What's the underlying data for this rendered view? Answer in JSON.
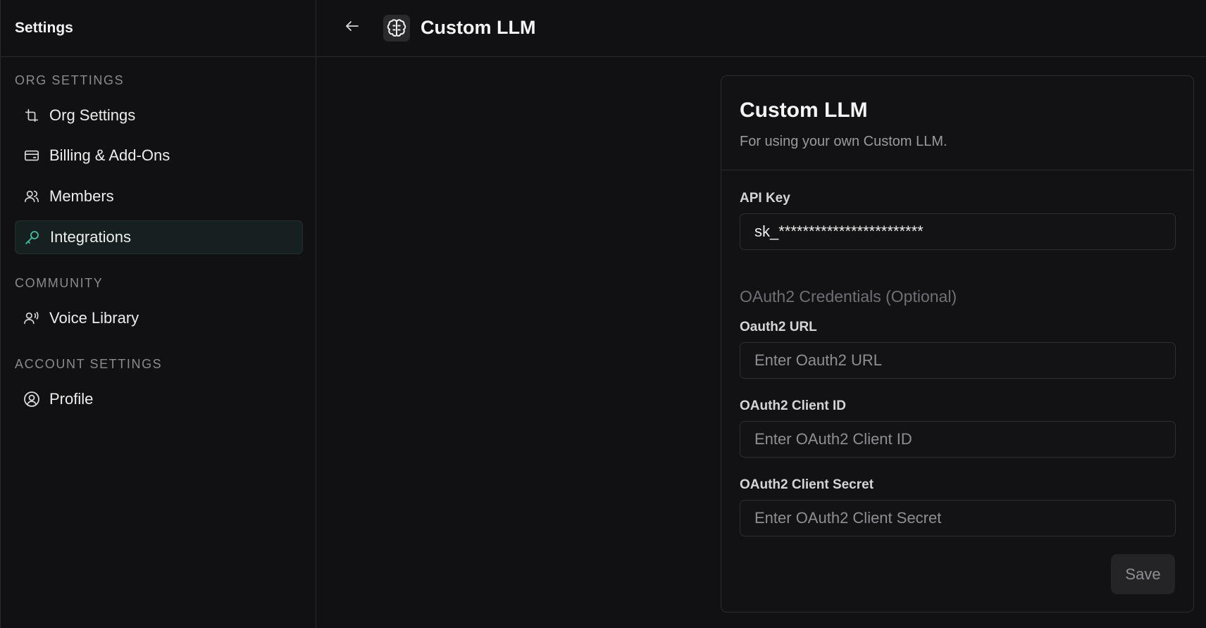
{
  "sidebar": {
    "title": "Settings",
    "sections": [
      {
        "label": "ORG SETTINGS",
        "items": [
          {
            "label": "Org Settings",
            "icon": "org-settings-icon"
          },
          {
            "label": "Billing & Add-Ons",
            "icon": "credit-card-icon"
          },
          {
            "label": "Members",
            "icon": "users-icon"
          },
          {
            "label": "Integrations",
            "icon": "key-icon",
            "active": true
          }
        ]
      },
      {
        "label": "COMMUNITY",
        "items": [
          {
            "label": "Voice Library",
            "icon": "voice-user-icon"
          }
        ]
      },
      {
        "label": "ACCOUNT SETTINGS",
        "items": [
          {
            "label": "Profile",
            "icon": "user-circle-icon"
          }
        ]
      }
    ]
  },
  "header": {
    "title": "Custom LLM",
    "back_icon": "arrow-left-icon",
    "app_icon": "brain-icon"
  },
  "card": {
    "title": "Custom LLM",
    "subtitle": "For using your own Custom LLM.",
    "api_key": {
      "label": "API Key",
      "value": "sk_************************"
    },
    "oauth_section_title": "OAuth2 Credentials (Optional)",
    "oauth_url": {
      "label": "Oauth2 URL",
      "placeholder": "Enter Oauth2 URL"
    },
    "client_id": {
      "label": "OAuth2 Client ID",
      "placeholder": "Enter OAuth2 Client ID"
    },
    "client_secret": {
      "label": "OAuth2 Client Secret",
      "placeholder": "Enter OAuth2 Client Secret"
    },
    "save_label": "Save"
  },
  "colors": {
    "background": "#111113",
    "accent": "#3dbfa0",
    "border": "#2a2a2d"
  }
}
